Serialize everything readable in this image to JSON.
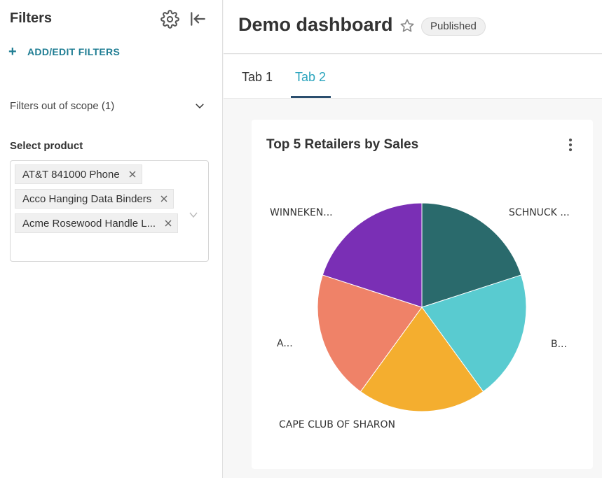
{
  "sidebar": {
    "title": "Filters",
    "add_filters_label": "ADD/EDIT FILTERS",
    "out_of_scope_label": "Filters out of scope (1)",
    "select_label": "Select product",
    "selected_products": [
      "AT&T 841000 Phone",
      "Acco Hanging Data Binders",
      "Acme Rosewood Handle L..."
    ],
    "icons": [
      "gear-icon",
      "collapse-left-icon",
      "plus-icon",
      "chevron-down-icon",
      "close-icon"
    ]
  },
  "header": {
    "title": "Demo dashboard",
    "status_badge": "Published",
    "icons": [
      "star-icon"
    ]
  },
  "tabs": [
    {
      "label": "Tab 1",
      "active": false
    },
    {
      "label": "Tab 2",
      "active": true
    }
  ],
  "card": {
    "title": "Top 5 Retailers by Sales",
    "icons": [
      "more-vertical-icon"
    ]
  },
  "chart_data": {
    "type": "pie",
    "title": "Top 5 Retailers by Sales",
    "categories": [
      "SCHNUCK ...",
      "B...",
      "CAPE CLUB OF SHARON",
      "A...",
      "WINNEKEN..."
    ],
    "values": [
      20,
      20,
      20,
      20,
      20
    ],
    "colors": [
      "#2a6a6c",
      "#59cbd0",
      "#f4ae2f",
      "#ef8268",
      "#7a2fb5"
    ]
  }
}
